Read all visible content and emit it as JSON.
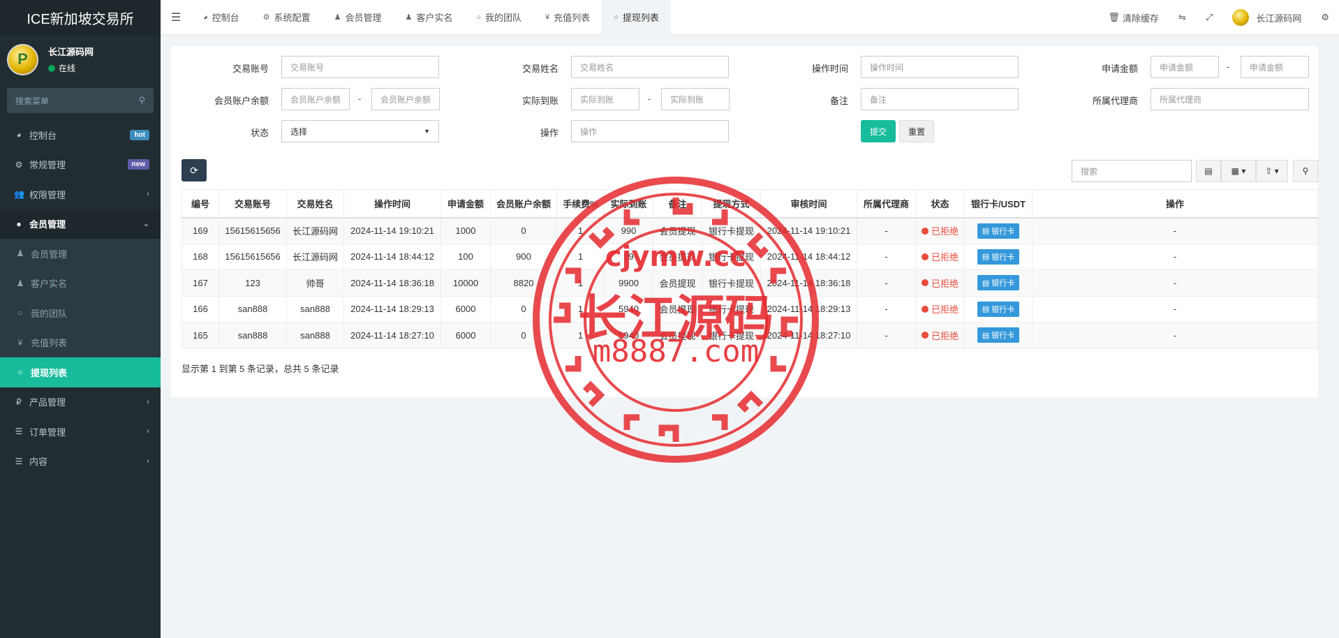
{
  "app": {
    "brand": "ICE新加坡交易所",
    "user_name": "长江源码网",
    "user_status": "在线",
    "avatar_letter": "P"
  },
  "sidebar": {
    "search_placeholder": "搜索菜单",
    "items": [
      {
        "label": "控制台",
        "icon": "dashboard-icon",
        "glyph": "◕",
        "badge": "hot"
      },
      {
        "label": "常规管理",
        "icon": "gears-icon",
        "glyph": "⚙",
        "badge": "new"
      },
      {
        "label": "权限管理",
        "icon": "group-icon",
        "glyph": "👥",
        "chevron": "‹"
      },
      {
        "label": "会员管理",
        "icon": "user-circle-icon",
        "glyph": "●",
        "chevron": "⌄"
      },
      {
        "label": "会员管理",
        "icon": "user-icon",
        "glyph": "♟"
      },
      {
        "label": "客户实名",
        "icon": "user-icon",
        "glyph": "♟"
      },
      {
        "label": "我的团队",
        "icon": "circle-o-icon",
        "glyph": "○"
      },
      {
        "label": "充值列表",
        "icon": "yen-icon",
        "glyph": "¥"
      },
      {
        "label": "提现列表",
        "icon": "circle-o-icon",
        "glyph": "○"
      },
      {
        "label": "产品管理",
        "icon": "ruble-icon",
        "glyph": "₽",
        "chevron": "‹"
      },
      {
        "label": "订单管理",
        "icon": "list-icon",
        "glyph": "☰",
        "chevron": "‹"
      },
      {
        "label": "内容",
        "icon": "list-icon",
        "glyph": "☰",
        "chevron": "‹"
      }
    ]
  },
  "topnav": {
    "tabs": [
      {
        "label": "控制台",
        "glyph": "◕",
        "icon": "dashboard-icon"
      },
      {
        "label": "系统配置",
        "glyph": "⚙",
        "icon": "gear-icon"
      },
      {
        "label": "会员管理",
        "glyph": "♟",
        "icon": "user-icon"
      },
      {
        "label": "客户实名",
        "glyph": "♟",
        "icon": "user-icon"
      },
      {
        "label": "我的团队",
        "glyph": "○",
        "icon": "circle-o-icon"
      },
      {
        "label": "充值列表",
        "glyph": "¥",
        "icon": "yen-icon"
      },
      {
        "label": "提现列表",
        "glyph": "○",
        "icon": "circle-o-icon"
      }
    ],
    "clear_cache": "清除缓存",
    "user_name": "长江源码网"
  },
  "filters": {
    "account_label": "交易账号",
    "account_ph": "交易账号",
    "name_label": "交易姓名",
    "name_ph": "交易姓名",
    "time_label": "操作时间",
    "time_ph": "操作时间",
    "amount_label": "申请金额",
    "amount_ph": "申请金额",
    "balance_label": "会员账户余额",
    "balance_ph": "会员账户余额",
    "actual_label": "实际到账",
    "actual_ph": "实际到账",
    "remark_label": "备注",
    "remark_ph": "备注",
    "agent_label": "所属代理商",
    "agent_ph": "所属代理商",
    "status_label": "状态",
    "status_value": "选择",
    "op_label": "操作",
    "op_ph": "操作",
    "dash": "-",
    "submit": "提交",
    "reset": "重置"
  },
  "toolbar": {
    "search_ph": "搜索"
  },
  "table": {
    "headers": [
      "编号",
      "交易账号",
      "交易姓名",
      "操作时间",
      "申请金额",
      "会员账户余额",
      "手续费%",
      "实际到账",
      "备注",
      "提现方式",
      "审核时间",
      "所属代理商",
      "状态",
      "银行卡/USDT",
      "操作"
    ],
    "rows": [
      {
        "id": "169",
        "account": "15615615656",
        "name": "长江源码网",
        "time": "2024-11-14 19:10:21",
        "amount": "1000",
        "balance": "0",
        "fee": "1",
        "actual": "990",
        "remark": "会员提现",
        "method": "银行卡提现",
        "audit": "2024-11-14 19:10:21",
        "agent": "-",
        "status": "已拒绝",
        "bank": "银行卡",
        "op": "-"
      },
      {
        "id": "168",
        "account": "15615615656",
        "name": "长江源码网",
        "time": "2024-11-14 18:44:12",
        "amount": "100",
        "balance": "900",
        "fee": "1",
        "actual": "99",
        "remark": "会员提现",
        "method": "银行卡提现",
        "audit": "2024-11-14 18:44:12",
        "agent": "-",
        "status": "已拒绝",
        "bank": "银行卡",
        "op": "-"
      },
      {
        "id": "167",
        "account": "123",
        "name": "帅哥",
        "time": "2024-11-14 18:36:18",
        "amount": "10000",
        "balance": "8820",
        "fee": "1",
        "actual": "9900",
        "remark": "会员提现",
        "method": "银行卡提现",
        "audit": "2024-11-14 18:36:18",
        "agent": "-",
        "status": "已拒绝",
        "bank": "银行卡",
        "op": "-"
      },
      {
        "id": "166",
        "account": "san888",
        "name": "san888",
        "time": "2024-11-14 18:29:13",
        "amount": "6000",
        "balance": "0",
        "fee": "1",
        "actual": "5940",
        "remark": "会员提现",
        "method": "银行卡提现",
        "audit": "2024-11-14 18:29:13",
        "agent": "-",
        "status": "已拒绝",
        "bank": "银行卡",
        "op": "-"
      },
      {
        "id": "165",
        "account": "san888",
        "name": "san888",
        "time": "2024-11-14 18:27:10",
        "amount": "6000",
        "balance": "0",
        "fee": "1",
        "actual": "5940",
        "remark": "会员提现",
        "method": "银行卡提现",
        "audit": "2024-11-14 18:27:10",
        "agent": "-",
        "status": "已拒绝",
        "bank": "银行卡",
        "op": "-"
      }
    ],
    "pager": "显示第 1 到第 5 条记录，总共 5 条记录"
  },
  "watermark": {
    "line1": "cjymw.cc",
    "line2": "长江源码",
    "line3": "m8887.com"
  }
}
